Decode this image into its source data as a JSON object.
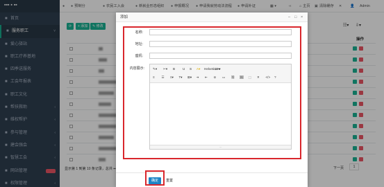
{
  "sidebar": {
    "logo": "▪▪▪ ▪ ▪▪",
    "items": [
      {
        "label": "首页",
        "icon": "home-icon"
      },
      {
        "label": "服务职工",
        "icon": "users-icon",
        "active": true,
        "arrow": "˅"
      },
      {
        "label": "爱心驿站",
        "icon": "heart-icon"
      },
      {
        "label": "职工疗养基地",
        "icon": "building-icon"
      },
      {
        "label": "四季送服务",
        "icon": "calendar-icon"
      },
      {
        "label": "工会年报表",
        "icon": "chart-icon"
      },
      {
        "label": "职工文化",
        "icon": "book-icon"
      },
      {
        "label": "帮扶救助",
        "icon": "hand-icon",
        "arrow": "‹"
      },
      {
        "label": "维权帮护",
        "icon": "shield-icon",
        "arrow": "‹"
      },
      {
        "label": "参与管理",
        "icon": "gavel-icon",
        "arrow": "‹"
      },
      {
        "label": "建会强会",
        "icon": "flag-icon",
        "arrow": "‹"
      },
      {
        "label": "智慧工会",
        "icon": "chip-icon",
        "arrow": "‹"
      },
      {
        "label": "网站管理",
        "icon": "globe-icon",
        "badge": "new"
      },
      {
        "label": "权限管理",
        "icon": "lock-icon",
        "arrow": "‹"
      }
    ]
  },
  "topbar": {
    "items": [
      {
        "label": "",
        "icon": "music-icon"
      },
      {
        "label": "预制分",
        "icon": "thumb-icon"
      },
      {
        "label": "农民工入会",
        "icon": "user-icon"
      },
      {
        "label": "新就业形态组织",
        "icon": "org-icon"
      },
      {
        "label": "申报概况",
        "icon": "circle-icon"
      },
      {
        "label": "申请我就劳动法流程",
        "icon": "circle-icon"
      },
      {
        "label": "申请补证",
        "icon": "doc-icon"
      }
    ],
    "right": {
      "main_page": "主页",
      "clear_cache": "清除缓存",
      "admin": "Admin"
    }
  },
  "modal": {
    "title": "添加",
    "fields": {
      "name": "名称:",
      "address": "地址:",
      "phone": "座机:",
      "detail": "内容展示:"
    },
    "editor": {
      "font_family": "Helvetica",
      "font_size": "13",
      "row1": [
        "✎▾",
        "✂▾",
        "B",
        "U",
        "S",
        "A▾",
        "Helvetica ▾",
        "13 ▾"
      ],
      "row2": [
        "≡",
        "☰",
        "≡▾",
        "T▾",
        "⊞▾",
        "⇥",
        "⇤",
        "⊝",
        "▭",
        "⛓",
        "🖼",
        "⬚",
        "✕",
        "</>",
        "?"
      ],
      "resize": "⋯"
    },
    "confirm": "确定",
    "reset": "重置",
    "controls": {
      "minimize": "–",
      "maximize": "□",
      "close": "×"
    }
  },
  "main": {
    "refresh_label": "⟳",
    "add_label": "+ 添加",
    "edit_label": "✎ 修改",
    "actions_header": "操作",
    "pager_info": "显示第 1 到第 10 条记录，总共 ▪▪ 条记录",
    "next_label": "下一页",
    "page_num": "1"
  },
  "colors": {
    "sidebar": "#2f4050",
    "accent": "#1ab394",
    "danger": "#ed5565",
    "primary": "#1c84c6",
    "highlight": "#d9262c"
  }
}
